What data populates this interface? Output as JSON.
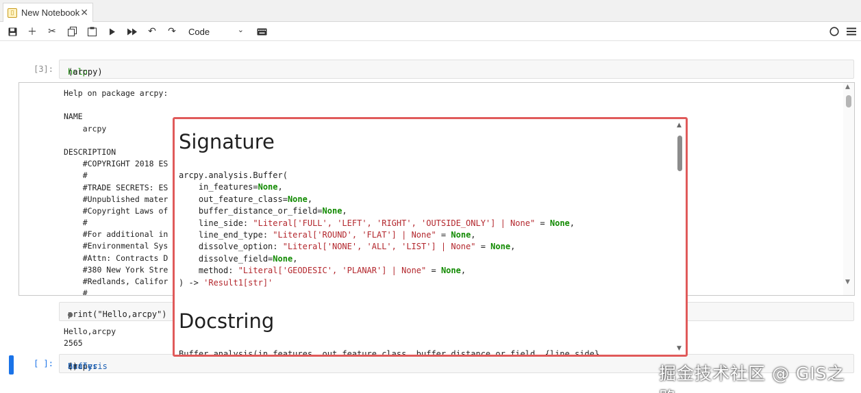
{
  "tab": {
    "title": "New Notebook",
    "icon": "notebook-icon",
    "close_glyph": "✕"
  },
  "toolbar": {
    "cell_type": "Code",
    "icons": [
      "save-icon",
      "add-icon",
      "cut-icon",
      "copy-icon",
      "paste-icon",
      "run-icon",
      "run-all-icon",
      "undo-icon",
      "redo-icon",
      "keyboard-icon",
      "kernel-status-icon",
      "menu-icon"
    ]
  },
  "cells": [
    {
      "prompt": "[3]:",
      "code_fn": "help",
      "code_rest": "(arcpy)"
    },
    {
      "prompt": "[ ]:",
      "code_obj": "arcpy.",
      "code_attr": "analysis",
      "code_dot": ".",
      "code_attr2": "Buffer",
      "code_end": "()"
    }
  ],
  "help_output": [
    "Help on package arcpy:",
    "",
    "NAME",
    "    arcpy",
    "",
    "DESCRIPTION",
    "    #COPYRIGHT 2018 ES",
    "    #",
    "    #TRADE SECRETS: ES",
    "    #Unpublished mater",
    "    #Copyright Laws of",
    "    #",
    "    #For additional in",
    "    #Environmental Sys",
    "    #Attn: Contracts D",
    "    #380 New York Stre",
    "    #Redlands, Califor",
    "    #"
  ],
  "print_cell": {
    "code": "print(\"Hello,arcpy\")",
    "marker": "●"
  },
  "stdout": [
    "Hello,arcpy",
    "2565"
  ],
  "popup": {
    "heading_signature": "Signature",
    "heading_docstring": "Docstring",
    "sig_head": "arcpy.analysis.Buffer(",
    "params": [
      {
        "pre": "    in_features=",
        "lit": "",
        "eq": "",
        "none": "None",
        "post": ","
      },
      {
        "pre": "    out_feature_class=",
        "lit": "",
        "eq": "",
        "none": "None",
        "post": ","
      },
      {
        "pre": "    buffer_distance_or_field=",
        "lit": "",
        "eq": "",
        "none": "None",
        "post": ","
      },
      {
        "pre": "    line_side: ",
        "lit": "\"Literal['FULL', 'LEFT', 'RIGHT', 'OUTSIDE_ONLY'] | None\"",
        "eq": " = ",
        "none": "None",
        "post": ","
      },
      {
        "pre": "    line_end_type: ",
        "lit": "\"Literal['ROUND', 'FLAT'] | None\"",
        "eq": " = ",
        "none": "None",
        "post": ","
      },
      {
        "pre": "    dissolve_option: ",
        "lit": "\"Literal['NONE', 'ALL', 'LIST'] | None\"",
        "eq": " = ",
        "none": "None",
        "post": ","
      },
      {
        "pre": "    dissolve_field=",
        "lit": "",
        "eq": "",
        "none": "None",
        "post": ","
      },
      {
        "pre": "    method: ",
        "lit": "\"Literal['GEODESIC', 'PLANAR'] | None\"",
        "eq": " = ",
        "none": "None",
        "post": ","
      }
    ],
    "sig_tail_pre": ") -> ",
    "sig_tail_ret": "'Result1[str]'",
    "doc_first_line": "Buffer_analysis(in_features, out_feature_class, buffer_distance_or_field, {line_side}"
  },
  "watermark": "掘金技术社区 @ GIS之路"
}
